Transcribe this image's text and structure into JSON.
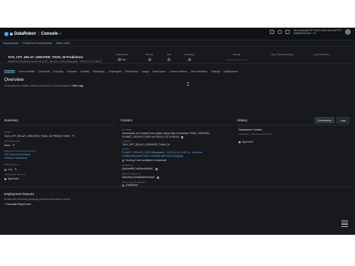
{
  "topbar": {
    "logo_text": "DataRobot",
    "app_name": "Console",
    "user_line1": "hba.ranks@PUFT-MKG-Alice.acXXeIfTTH",
    "user_line2": "DataRobot.com, Y4"
  },
  "nav": {
    "items": [
      "Deployments",
      "Prediction Environments",
      "Batch Jobs"
    ]
  },
  "header": {
    "title": "TAXI_CFF_DELAY_GREATER_THAN_20 Predictions",
    "subtitle": "DataRobot.Prediction-Server: PLANET_DELAYS_DATA (Wrangled) · 2023-11-22 14:55:03",
    "stats": [
      {
        "label": "Importance",
        "value": "Low"
      },
      {
        "label": "Service",
        "value": ""
      },
      {
        "label": "Drift",
        "value": ""
      },
      {
        "label": "Accuracy",
        "value": ""
      },
      {
        "label": "Activity",
        "value": ""
      },
      {
        "label": "Avg. Predictions/Day",
        "value": ""
      },
      {
        "label": "Last Prediction",
        "value": ""
      }
    ]
  },
  "tabs": [
    "Overview",
    "Service Health",
    "Data Drift",
    "Accuracy",
    "Fairness",
    "Humility",
    "Retraining",
    "Challengers",
    "Predictions",
    "Usage",
    "Data Export",
    "Custom Metrics",
    "Job Definitions",
    "Settings",
    "Notifications"
  ],
  "overview": {
    "title": "Overview",
    "desc": "Understand the details, context, and history of this deployment.",
    "desc_link": "View Logs"
  },
  "summary": {
    "title": "Summary",
    "fields": [
      {
        "label": "NAME",
        "value": "TAXI_CFF_DELAY_GREATER_THAN_20 PREDICTIONS"
      },
      {
        "label": "DESCRIPTION",
        "value": "None"
      },
      {
        "label": "PREDICTION ENVIRONMENT",
        "value": "DR Cloud Environment"
      },
      {
        "label": "",
        "value": "Platform: DataRobot"
      },
      {
        "label": "IMPORTANCE",
        "value": "Low"
      },
      {
        "label": "APPROVAL STATUS",
        "value": "Approved"
      }
    ]
  },
  "content": {
    "title": "Content",
    "fields": [
      {
        "label": "DATASET",
        "value": "Substantial-Jet-Created from Intake using Data Connection TRAIL_SEASON..."
      },
      {
        "label": "",
        "value": "PLANET_DELAYS_DATA on 2023-11-22 14:55:03"
      },
      {
        "label": "TARGET",
        "value": "TAXI_OFF_DELAY_GREATER_THAN_20"
      },
      {
        "label": "MODEL",
        "value": "PLANET_DELAYS_DATA (Wrangled) - 2023-11-22 14:57:41 - eXtreme"
      },
      {
        "label": "",
        "value": "Gradient Boosted Trees Classifier with Early Stopping"
      },
      {
        "label": "",
        "value": "Scoring Code available to download"
      },
      {
        "label": "MODEL ID",
        "value": "65b3e9f0f27af3f6e4b083d7"
      },
      {
        "label": "DEPLOYMENT ID",
        "value": "65b3f9a2c22a8b06f4e0a3b2"
      },
      {
        "label": "BUILD ENVIRONMENT",
        "value": "DataRobot"
      },
      {
        "label": "PROJECT",
        "value": "PLANET_DELAYS_DATA (Wrangled) · 2023-11-22 14:55:03 · 2023-11-22 14:57:41"
      },
      {
        "label": "PREDICTION TYPE",
        "value": "Classification"
      }
    ]
  },
  "history": {
    "title": "History",
    "governance_btn": "Governance",
    "logs_btn": "Logs",
    "event_title": "Deployment Created",
    "event_meta": "11/22/2023 · Test Automation Admin",
    "event_status": "Approved"
  },
  "reports": {
    "title": "Deployment Reports",
    "desc": "Review and download previously generated deployment reports.",
    "button": "+ Generate Report now"
  }
}
